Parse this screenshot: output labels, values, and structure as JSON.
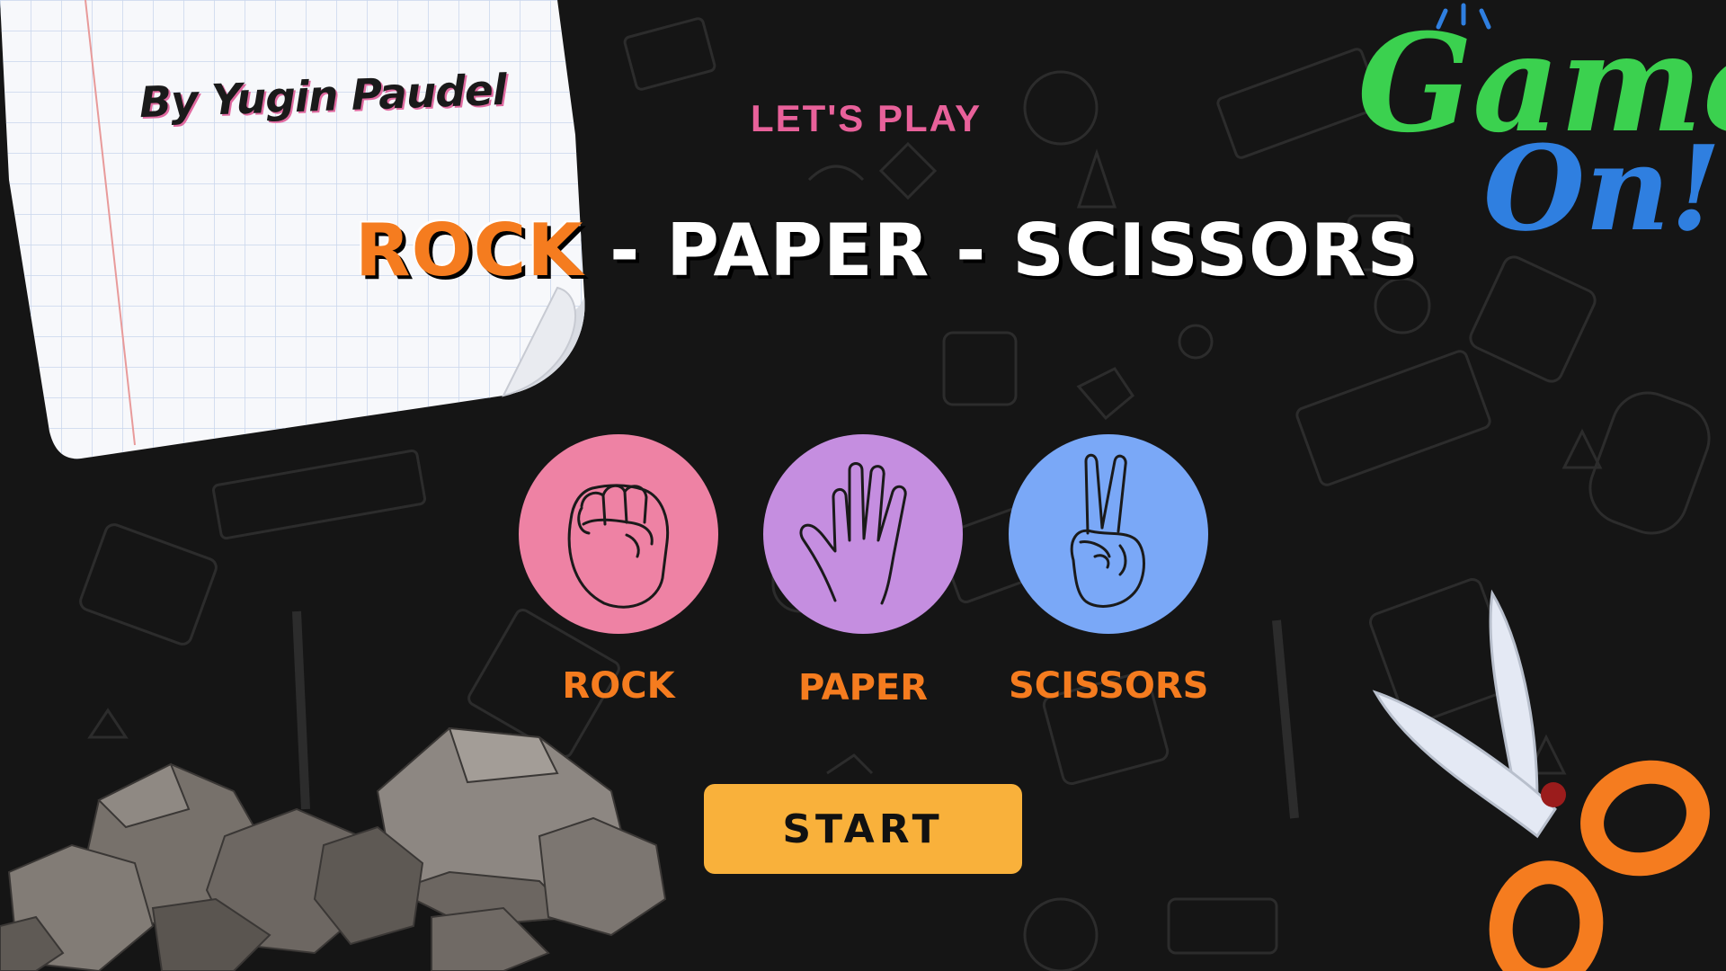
{
  "note": {
    "author_text": "By Yugin Paudel"
  },
  "header": {
    "subtitle": "LET'S PLAY",
    "title_rock": "ROCK",
    "title_rest": " - PAPER - SCISSORS"
  },
  "choices": [
    {
      "label": "ROCK",
      "icon": "fist-icon",
      "color": "#ee82a4"
    },
    {
      "label": "PAPER",
      "icon": "open-hand-icon",
      "color": "#c58ee0"
    },
    {
      "label": "SCISSORS",
      "icon": "peace-hand-icon",
      "color": "#7aa8f7"
    }
  ],
  "start_button": {
    "label": "START",
    "color": "#f9b13b"
  },
  "badge": {
    "line1": "Game",
    "line2": "On!"
  },
  "colors": {
    "background": "#151515",
    "accent_orange": "#f57c1f",
    "accent_pink": "#e8619a",
    "badge_green": "#3bd14f",
    "badge_blue": "#2f7fe0"
  }
}
